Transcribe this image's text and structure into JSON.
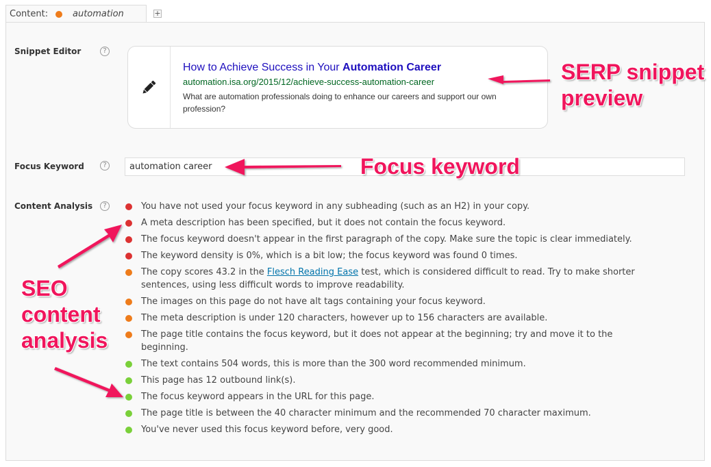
{
  "tab": {
    "label": "Content:",
    "keyword": "automation career",
    "status_color": "#ee7c1b",
    "add_label": "+"
  },
  "snippet_editor": {
    "label": "Snippet Editor",
    "help": "?",
    "icon": "pencil-icon",
    "title_prefix": "How to Achieve Success in Your ",
    "title_keyword": "Automation Career",
    "url": "automation.isa.org/2015/12/achieve-success-automation-career",
    "description": "What are automation professionals doing to enhance our careers and support our own profession?"
  },
  "focus_keyword": {
    "label": "Focus Keyword",
    "help": "?",
    "value": "automation career"
  },
  "content_analysis": {
    "label": "Content Analysis",
    "help": "?",
    "colors": {
      "red": "#dc3232",
      "orange": "#ee7c1b",
      "green": "#7ad03a"
    },
    "items": [
      {
        "status": "red",
        "text": "You have not used your focus keyword in any subheading (such as an H2) in your copy."
      },
      {
        "status": "red",
        "text": "A meta description has been specified, but it does not contain the focus keyword."
      },
      {
        "status": "red",
        "text": "The focus keyword doesn't appear in the first paragraph of the copy. Make sure the topic is clear immediately."
      },
      {
        "status": "red",
        "text": "The keyword density is 0%, which is a bit low; the focus keyword was found 0 times."
      },
      {
        "status": "orange",
        "text_before": "The copy scores 43.2 in the ",
        "link": "Flesch Reading Ease",
        "text_after": " test, which is considered difficult to read. Try to make shorter sentences, using less difficult words to improve readability."
      },
      {
        "status": "orange",
        "text": "The images on this page do not have alt tags containing your focus keyword."
      },
      {
        "status": "orange",
        "text": "The meta description is under 120 characters, however up to 156 characters are available."
      },
      {
        "status": "orange",
        "text": "The page title contains the focus keyword, but it does not appear at the beginning; try and move it to the beginning."
      },
      {
        "status": "green",
        "text": "The text contains 504 words, this is more than the 300 word recommended minimum."
      },
      {
        "status": "green",
        "text": "This page has 12 outbound link(s)."
      },
      {
        "status": "green",
        "text": "The focus keyword appears in the URL for this page."
      },
      {
        "status": "green",
        "text": "The page title is between the 40 character minimum and the recommended 70 character maximum."
      },
      {
        "status": "green",
        "text": "You've never used this focus keyword before, very good."
      }
    ]
  },
  "annotations": {
    "serp_line1": "SERP snippet",
    "serp_line2": "preview",
    "focus": "Focus keyword",
    "seo_line1": "SEO",
    "seo_line2": "content",
    "seo_line3": "analysis",
    "color": "#f0155c"
  }
}
